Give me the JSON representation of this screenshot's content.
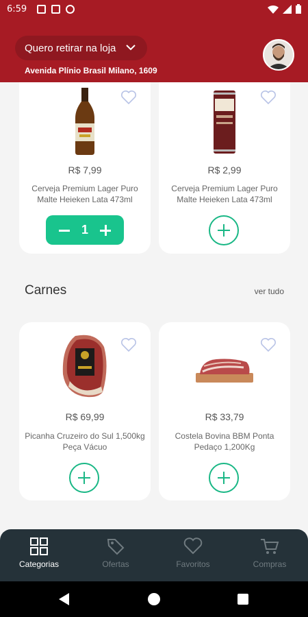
{
  "status_bar": {
    "time": "6:59"
  },
  "header": {
    "pickup_label": "Quero retirar na loja",
    "address": "Avenida Plínio Brasil Milano, 1609"
  },
  "colors": {
    "brand_red": "#a71b24",
    "accent_green": "#19c48d",
    "nav_bg": "#253239"
  },
  "products_top": [
    {
      "price": "R$ 7,99",
      "name": "Cerveja Premium Lager Puro Malte Heieken Lata 473ml",
      "quantity": "1"
    },
    {
      "price": "R$ 2,99",
      "name": "Cerveja Premium Lager Puro Malte Heieken Lata 473ml"
    }
  ],
  "section": {
    "title": "Carnes",
    "see_all": "ver tudo"
  },
  "products_meat": [
    {
      "price": "R$ 69,99",
      "name": "Picanha Cruzeiro do Sul 1,500kg Peça Vácuo"
    },
    {
      "price": "R$ 33,79",
      "name": "Costela Bovina BBM Ponta Pedaço 1,200Kg"
    }
  ],
  "nav": [
    {
      "label": "Categorias",
      "icon": "grid-icon",
      "active": true
    },
    {
      "label": "Ofertas",
      "icon": "tag-icon"
    },
    {
      "label": "Favoritos",
      "icon": "heart-icon"
    },
    {
      "label": "Compras",
      "icon": "cart-icon"
    }
  ]
}
